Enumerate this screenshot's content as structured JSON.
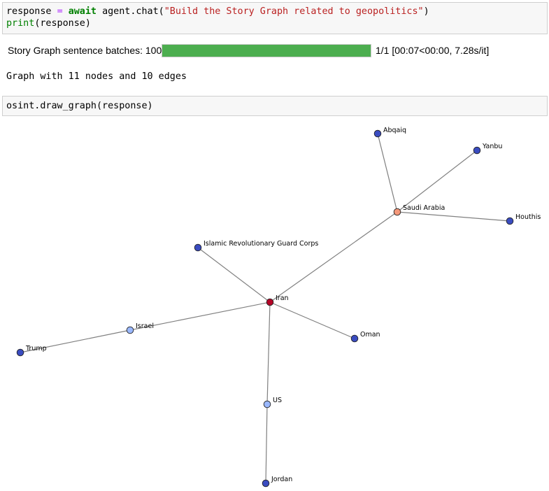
{
  "cells": {
    "input1": {
      "v_response": "response",
      "op_eq": "=",
      "kw_await": "await",
      "call_agent": "agent.chat(",
      "arg_string": "\"Build the Story Graph related to geopolitics\"",
      "close_paren": ")",
      "fn_print": "print",
      "print_args": "(response)"
    },
    "input2": {
      "line": "osint.draw_graph(response)"
    }
  },
  "progress": {
    "label": "Story Graph sentence batches: 100%",
    "percent": 100,
    "stats": "1/1 [00:07<00:00,  7.28s/it]",
    "fill_color": "#4cae4f"
  },
  "output": {
    "summary": "Graph with 11 nodes and 10 edges"
  },
  "graph": {
    "nodes": [
      {
        "id": "abqaiq",
        "label": "Abqaiq",
        "color": "#3a4cc0"
      },
      {
        "id": "yanbu",
        "label": "Yanbu",
        "color": "#3a4cc0"
      },
      {
        "id": "saudi",
        "label": "Saudi Arabia",
        "color": "#f4987a"
      },
      {
        "id": "houthis",
        "label": "Houthis",
        "color": "#3a4cc0"
      },
      {
        "id": "irgc",
        "label": "Islamic Revolutionary Guard Corps",
        "color": "#3a4cc0"
      },
      {
        "id": "iran",
        "label": "Iran",
        "color": "#b40426"
      },
      {
        "id": "israel",
        "label": "Israel",
        "color": "#9ab8fe"
      },
      {
        "id": "oman",
        "label": "Oman",
        "color": "#3a4cc0"
      },
      {
        "id": "trump",
        "label": "Trump",
        "color": "#3a4cc0"
      },
      {
        "id": "us",
        "label": "US",
        "color": "#9ab8fe"
      },
      {
        "id": "jordan",
        "label": "Jordan",
        "color": "#3a4cc0"
      }
    ],
    "edges": [
      [
        "abqaiq",
        "saudi"
      ],
      [
        "yanbu",
        "saudi"
      ],
      [
        "saudi",
        "houthis"
      ],
      [
        "saudi",
        "iran"
      ],
      [
        "irgc",
        "iran"
      ],
      [
        "iran",
        "israel"
      ],
      [
        "iran",
        "oman"
      ],
      [
        "iran",
        "us"
      ],
      [
        "israel",
        "trump"
      ],
      [
        "us",
        "jordan"
      ]
    ],
    "edge_color": "#808080"
  }
}
